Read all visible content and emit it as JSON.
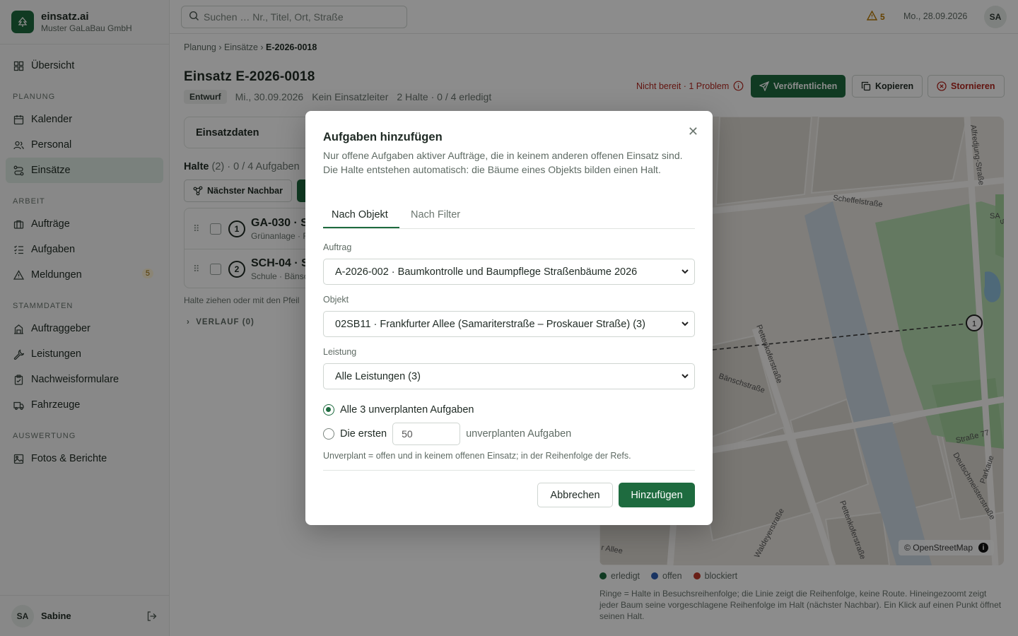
{
  "brand": {
    "name": "einsatz.ai",
    "org": "Muster GaLaBau GmbH"
  },
  "sidebar": {
    "overview": "Übersicht",
    "sections": [
      {
        "title": "PLANUNG",
        "items": [
          "Kalender",
          "Personal",
          "Einsätze"
        ]
      },
      {
        "title": "ARBEIT",
        "items": [
          "Aufträge",
          "Aufgaben",
          "Meldungen"
        ]
      },
      {
        "title": "STAMMDATEN",
        "items": [
          "Auftraggeber",
          "Leistungen",
          "Nachweisformulare",
          "Fahrzeuge"
        ]
      },
      {
        "title": "AUSWERTUNG",
        "items": [
          "Fotos & Berichte"
        ]
      }
    ],
    "meldungen_badge": "5",
    "user_initials": "SA",
    "user_name": "Sabine"
  },
  "topbar": {
    "search_placeholder": "Suchen … Nr., Titel, Ort, Straße",
    "alert_count": "5",
    "date": "Mo., 28.09.2026",
    "avatar": "SA"
  },
  "main": {
    "breadcrumb": [
      "Planung",
      "Einsätze",
      "E-2026-0018"
    ],
    "title": "Einsatz E-2026-0018",
    "status": "Entwurf",
    "date": "Mi., 30.09.2026",
    "leader": "Kein Einsatzleiter",
    "summary": "2 Halte · 0 / 4 erledigt",
    "not_ready": "Nicht bereit · 1 Problem",
    "publish": "Veröffentlichen",
    "copy": "Kopieren",
    "cancel": "Stornieren",
    "section_data": "Einsatzdaten",
    "halte_label": "Halte",
    "halte_sub": "(2) · 0 / 4 Aufgaben",
    "nachbar_btn": "Nächster Nachbar",
    "stops": [
      {
        "num": "1",
        "code": "GA-030 · S",
        "sub": "Grünanlage · R"
      },
      {
        "num": "2",
        "code": "SCH-04 · S",
        "sub": "Schule · Bänsc"
      }
    ],
    "hint": "Halte ziehen oder mit den Pfeil",
    "verlauf": "VERLAUF (0)"
  },
  "map": {
    "streets": [
      "Scheffelstraße",
      "Alfredjung-Straße",
      "Pettenkoferstraße",
      "Bänschstraße",
      "Straße 77",
      "Deutschmeisterstraße",
      "Parkaue",
      "Waldeyerstraße",
      "Pettenkoferstraße",
      "r Allee",
      "SA",
      "S"
    ],
    "marker": "1",
    "attribution": "© OpenStreetMap",
    "legend": [
      {
        "label": "erledigt",
        "color": "#1e6b3f"
      },
      {
        "label": "offen",
        "color": "#2f5fb3"
      },
      {
        "label": "blockiert",
        "color": "#c0392b"
      }
    ],
    "note": "Ringe = Halte in Besuchsreihenfolge; die Linie zeigt die Reihenfolge, keine Route. Hineingezoomt zeigt jeder Baum seine vorgeschlagene Reihenfolge im Halt (nächster Nachbar). Ein Klick auf einen Punkt öffnet seinen Halt."
  },
  "modal": {
    "title": "Aufgaben hinzufügen",
    "description": "Nur offene Aufgaben aktiver Aufträge, die in keinem anderen offenen Einsatz sind. Die Halte entstehen automatisch: die Bäume eines Objekts bilden einen Halt.",
    "tabs": [
      "Nach Objekt",
      "Nach Filter"
    ],
    "auftrag_label": "Auftrag",
    "auftrag_value": "A-2026-002 · Baumkontrolle und Baumpflege Straßenbäume 2026",
    "objekt_label": "Objekt",
    "objekt_value": "02SB11 · Frankfurter Allee (Samariterstraße – Proskauer Straße) (3)",
    "leistung_label": "Leistung",
    "leistung_value": "Alle Leistungen (3)",
    "radio_all": "Alle 3 unverplanten Aufgaben",
    "radio_first": "Die ersten",
    "first_value": "50",
    "radio_first_suffix": "unverplanten Aufgaben",
    "note": "Unverplant = offen und in keinem offenen Einsatz; in der Reihenfolge der Refs.",
    "cancel": "Abbrechen",
    "add": "Hinzufügen"
  }
}
